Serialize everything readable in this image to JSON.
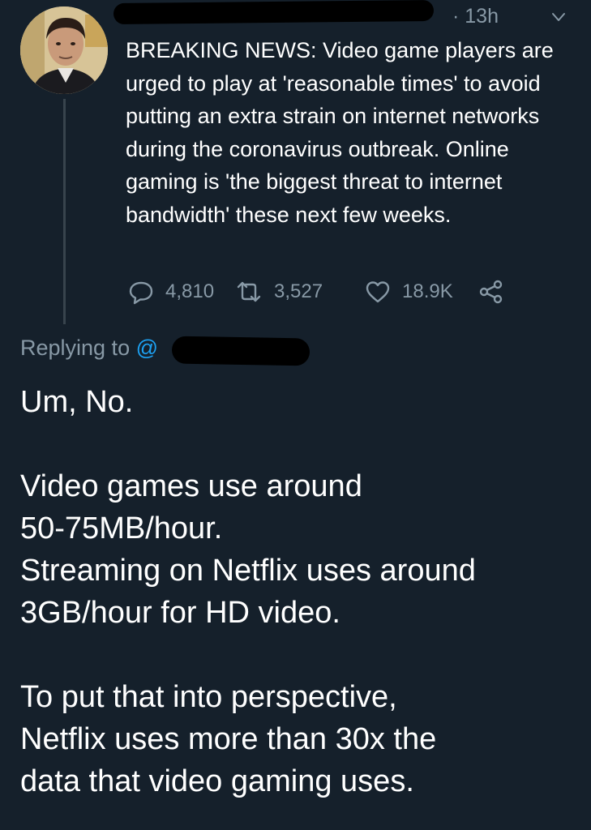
{
  "tweet": {
    "time": "· 13h",
    "text": "BREAKING NEWS: Video game players are urged to play at 'reasonable times' to avoid putting an extra strain on internet networks during the coronavirus outbreak. Online gaming is 'the biggest threat to internet bandwidth' these next few weeks.",
    "replies": "4,810",
    "retweets": "3,527",
    "likes": "18.9K"
  },
  "reply": {
    "replying_to_label": "Replying to ",
    "replying_to_handle": "@",
    "lines": [
      "Um, No.",
      "",
      "Video games use around",
      "50-75MB/hour.",
      "Streaming on Netflix uses around",
      "3GB/hour for HD video.",
      "",
      "To put that into perspective,",
      "Netflix uses more than 30x the",
      "data that video gaming uses."
    ]
  },
  "colors": {
    "background": "#15202b",
    "text": "#ffffff",
    "secondary": "#8899a6",
    "link": "#1da1f2",
    "thread_line": "#38444d"
  },
  "icons": [
    "chevron-down-icon",
    "reply-icon",
    "retweet-icon",
    "like-icon",
    "share-icon"
  ]
}
